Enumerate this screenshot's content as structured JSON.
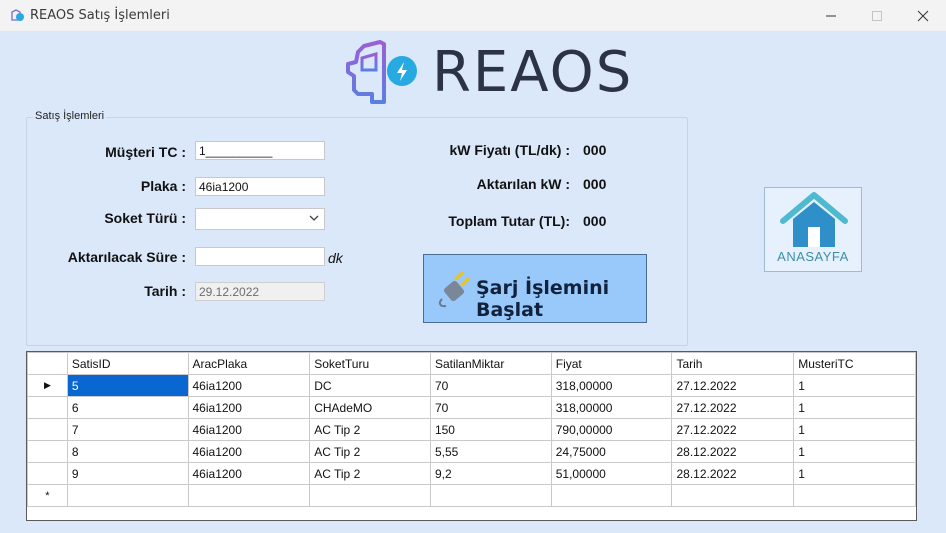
{
  "window": {
    "title": "REAOS Satış İşlemleri",
    "controls": [
      "minimize-icon",
      "maximize-icon",
      "close-icon"
    ]
  },
  "logo": {
    "text": "REAOS"
  },
  "form": {
    "group_title": "Satış İşlemleri",
    "labels": {
      "customer_tc": "Müşteri TC :",
      "plate": "Plaka :",
      "socket_type": "Soket Türü :",
      "duration": "Aktarılacak Süre :",
      "date": "Tarih :"
    },
    "customer_tc_value": "1__________",
    "plate_value": "46ia1200",
    "socket_type_value": "",
    "duration_value": "",
    "duration_unit": "dk",
    "date_value": "29.12.2022"
  },
  "pricing": {
    "kw_price_label": "kW Fiyatı (TL/dk) :",
    "kw_price_value": "000",
    "transferred_label": "Aktarılan kW :",
    "transferred_value": "000",
    "total_label": "Toplam Tutar (TL):",
    "total_value": "000"
  },
  "start_button": {
    "label": "Şarj İşlemini Başlat",
    "icon": "charging-plug-icon"
  },
  "home_button": {
    "label": "ANASAYFA",
    "icon": "home-icon"
  },
  "grid": {
    "columns": [
      "SatisID",
      "AracPlaka",
      "SoketTuru",
      "SatilanMiktar",
      "Fiyat",
      "Tarih",
      "MusteriTC"
    ],
    "rows": [
      [
        "5",
        "46ia1200",
        "DC",
        "70",
        "318,00000",
        "27.12.2022",
        "1"
      ],
      [
        "6",
        "46ia1200",
        "CHAdeMO",
        "70",
        "318,00000",
        "27.12.2022",
        "1"
      ],
      [
        "7",
        "46ia1200",
        "AC Tip 2",
        "150",
        "790,00000",
        "27.12.2022",
        "1"
      ],
      [
        "8",
        "46ia1200",
        "AC Tip 2",
        "5,55",
        "24,75000",
        "28.12.2022",
        "1"
      ],
      [
        "9",
        "46ia1200",
        "AC Tip 2",
        "9,2",
        "51,00000",
        "28.12.2022",
        "1"
      ]
    ],
    "current_row_marker": "▶",
    "new_row_marker": "*"
  },
  "colors": {
    "background": "#dbe8fa",
    "start_button": "#99c8fa",
    "selection": "#0a66d0",
    "logo_accent": "#27a9e1"
  }
}
